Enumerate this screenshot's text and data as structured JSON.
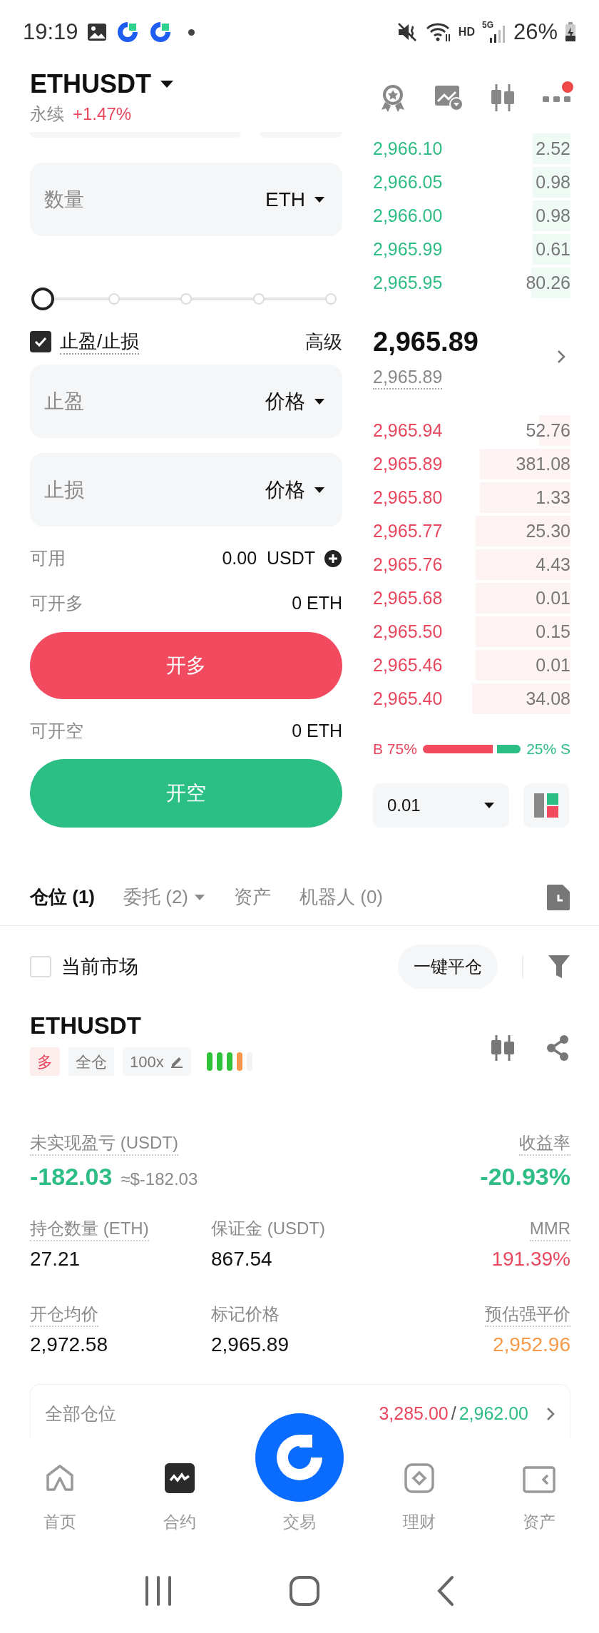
{
  "status_bar": {
    "time": "19:19",
    "network": "HD",
    "signal": "5G",
    "battery": "26%"
  },
  "header": {
    "symbol": "ETHUSDT",
    "contract_type": "永续",
    "change": "+1.47%",
    "alert_dot": true
  },
  "order_form": {
    "quantity_field": {
      "placeholder": "数量",
      "unit": "ETH"
    },
    "slider": {
      "level": 0
    },
    "tpsl": {
      "label": "止盈/止损",
      "checked": true,
      "advanced": "高级"
    },
    "tp_field": {
      "placeholder": "止盈",
      "unit": "价格"
    },
    "sl_field": {
      "placeholder": "止损",
      "unit": "价格"
    },
    "info_rows": [
      {
        "label": "可用",
        "value": "0.00  USDT",
        "add": true
      },
      {
        "label": "可开多",
        "value": "0 ETH",
        "add": false
      }
    ],
    "long_button": "开多",
    "short_info": {
      "label": "可开空",
      "value": "0 ETH"
    },
    "short_button": "开空"
  },
  "order_book": {
    "asks": [
      {
        "price": "2,966.10",
        "qty": "2.52",
        "level": 0.19
      },
      {
        "price": "2,966.05",
        "qty": "0.98",
        "level": 0.19
      },
      {
        "price": "2,966.00",
        "qty": "0.98",
        "level": 0.19
      },
      {
        "price": "2,965.99",
        "qty": "0.61",
        "level": 0.19
      },
      {
        "price": "2,965.95",
        "qty": "80.26",
        "level": 0.2
      }
    ],
    "last_price": "2,965.89",
    "mark_price": "2,965.89",
    "bids": [
      {
        "price": "2,965.94",
        "qty": "52.76",
        "level": 0.16
      },
      {
        "price": "2,965.89",
        "qty": "381.08",
        "level": 0.46
      },
      {
        "price": "2,965.80",
        "qty": "1.33",
        "level": 0.46
      },
      {
        "price": "2,965.77",
        "qty": "25.30",
        "level": 0.48
      },
      {
        "price": "2,965.76",
        "qty": "4.43",
        "level": 0.48
      },
      {
        "price": "2,965.68",
        "qty": "0.01",
        "level": 0.48
      },
      {
        "price": "2,965.50",
        "qty": "0.15",
        "level": 0.48
      },
      {
        "price": "2,965.46",
        "qty": "0.01",
        "level": 0.48
      },
      {
        "price": "2,965.40",
        "qty": "34.08",
        "level": 0.5
      }
    ],
    "ratio": {
      "buy_label": "B 75%",
      "sell_label": "25% S",
      "level": 0.75
    },
    "precision": "0.01"
  },
  "tabs": [
    {
      "label": "仓位 (1)",
      "selected": true,
      "dropdown": false
    },
    {
      "label": "委托 (2)",
      "selected": false,
      "dropdown": true
    },
    {
      "label": "资产",
      "selected": false,
      "dropdown": false
    },
    {
      "label": "机器人 (0)",
      "selected": false,
      "dropdown": false
    }
  ],
  "filter": {
    "label": "当前市场",
    "checked": false,
    "close_all": "一键平仓"
  },
  "position": {
    "symbol": "ETHUSDT",
    "tags": [
      {
        "kind": "side",
        "label": "多"
      },
      {
        "kind": "margin",
        "label": "全仓"
      },
      {
        "kind": "leverage",
        "label": "100x"
      }
    ],
    "risk_bars": [
      {
        "color": "#2ec23b"
      },
      {
        "color": "#2ec23b"
      },
      {
        "color": "#2ec23b"
      },
      {
        "color": "#f7964a"
      },
      {
        "color": "#f2f2f2"
      }
    ],
    "stat_rows": [
      [
        {
          "label": "未实现盈亏 (USDT)",
          "value": "-182.03",
          "note": "≈$-182.03",
          "color": "#2ebd85",
          "dotted": true
        },
        {
          "label": "收益率",
          "value": "-20.93%",
          "color": "#2ebd85",
          "dotted": true
        }
      ],
      [
        {
          "label": "持仓数量 (ETH)",
          "value": "27.21",
          "color": "#111111",
          "dotted": true
        },
        {
          "label": "保证金 (USDT)",
          "value": "867.54",
          "color": "#111111",
          "dotted": false
        },
        {
          "label": "MMR",
          "value": "191.39%",
          "color": "#e8475e",
          "dotted": true
        }
      ],
      [
        {
          "label": "开仓均价",
          "value": "2,972.58",
          "color": "#111111",
          "dotted": true
        },
        {
          "label": "标记价格",
          "value": "2,965.89",
          "color": "#111111",
          "dotted": false
        },
        {
          "label": "预估强平价",
          "value": "2,952.96",
          "color": "#f59a4a",
          "dotted": true
        }
      ]
    ],
    "summary": {
      "label": "全部仓位",
      "long_value": "3,285.00",
      "separator": "/",
      "short_value": "2,962.00"
    }
  },
  "bottom_nav": [
    {
      "kind": "home",
      "label": "首页",
      "selected": false
    },
    {
      "kind": "futures",
      "label": "合约",
      "selected": true
    },
    {
      "kind": "trade",
      "label": "交易",
      "selected": false
    },
    {
      "kind": "earn",
      "label": "理财",
      "selected": false
    },
    {
      "kind": "assets",
      "label": "资产",
      "selected": false
    }
  ]
}
